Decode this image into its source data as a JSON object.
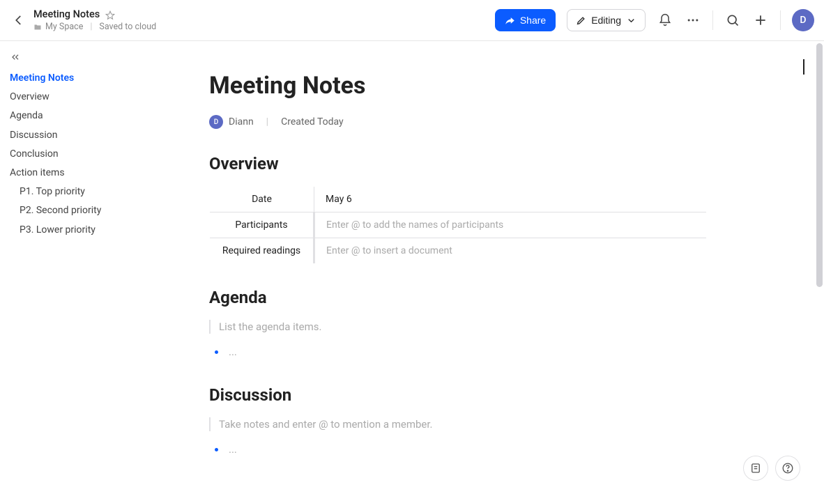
{
  "header": {
    "title": "Meeting Notes",
    "space": "My Space",
    "save_status": "Saved to cloud",
    "share_label": "Share",
    "editing_label": "Editing",
    "avatar_letter": "D"
  },
  "outline": {
    "items": [
      {
        "label": "Meeting Notes",
        "active": true,
        "sub": false
      },
      {
        "label": "Overview",
        "active": false,
        "sub": false
      },
      {
        "label": "Agenda",
        "active": false,
        "sub": false
      },
      {
        "label": "Discussion",
        "active": false,
        "sub": false
      },
      {
        "label": "Conclusion",
        "active": false,
        "sub": false
      },
      {
        "label": "Action items",
        "active": false,
        "sub": false
      },
      {
        "label": "P1. Top priority",
        "active": false,
        "sub": true
      },
      {
        "label": "P2. Second priority",
        "active": false,
        "sub": true
      },
      {
        "label": "P3. Lower priority",
        "active": false,
        "sub": true
      }
    ]
  },
  "doc": {
    "title": "Meeting Notes",
    "author": {
      "name": "Diann",
      "initial": "D"
    },
    "created": "Created Today",
    "overview": {
      "heading": "Overview",
      "rows": [
        {
          "label": "Date",
          "value": "May 6",
          "placeholder": false
        },
        {
          "label": "Participants",
          "value": "Enter @ to add the names of participants",
          "placeholder": true
        },
        {
          "label": "Required readings",
          "value": "Enter @ to insert a document",
          "placeholder": true
        }
      ]
    },
    "agenda": {
      "heading": "Agenda",
      "hint": "List the agenda items.",
      "bullet": "..."
    },
    "discussion": {
      "heading": "Discussion",
      "hint": "Take notes and enter @ to mention a member.",
      "bullet": "..."
    }
  }
}
